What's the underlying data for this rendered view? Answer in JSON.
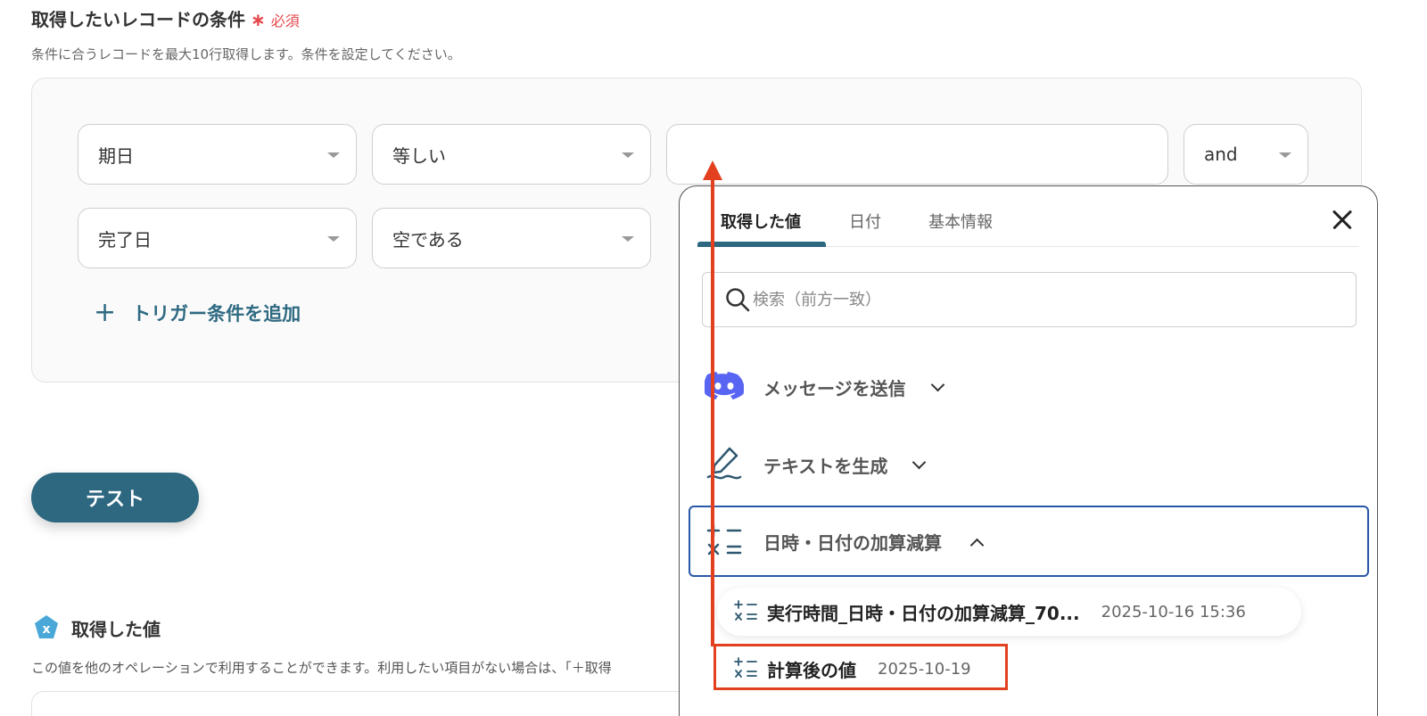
{
  "section": {
    "title": "取得したいレコードの条件",
    "required_star": "∗",
    "required_label": "必須",
    "description": "条件に合うレコードを最大10行取得します。条件を設定してください。"
  },
  "conditions": {
    "row1": {
      "field": "期日",
      "operator": "等しい",
      "value": "",
      "logic": "and"
    },
    "row2": {
      "field": "完了日",
      "operator": "空である"
    },
    "add_label": "トリガー条件を追加"
  },
  "test_button": "テスト",
  "acquired": {
    "title": "取得した値",
    "description": "この値を他のオペレーションで利用することができます。利用したい項目がない場合は、「＋取得"
  },
  "popup": {
    "tabs": [
      "取得した値",
      "日付",
      "基本情報"
    ],
    "search_placeholder": "検索（前方一致）",
    "groups": [
      {
        "label": "メッセージを送信",
        "icon": "discord-icon",
        "expanded": false
      },
      {
        "label": "テキストを生成",
        "icon": "pen-icon",
        "expanded": false
      },
      {
        "label": "日時・日付の加算減算",
        "icon": "calc-icon",
        "expanded": true
      }
    ],
    "items": [
      {
        "name": "実行時間_日時・日付の加算減算_70...",
        "date": "2025-10-16 15:36"
      },
      {
        "name": "計算後の値",
        "date": "2025-10-19"
      }
    ]
  },
  "colors": {
    "primary": "#2d6780",
    "required": "#e5484d",
    "highlight": "#e2401e",
    "selected_border": "#2857a8",
    "discord": "#5865f2"
  }
}
